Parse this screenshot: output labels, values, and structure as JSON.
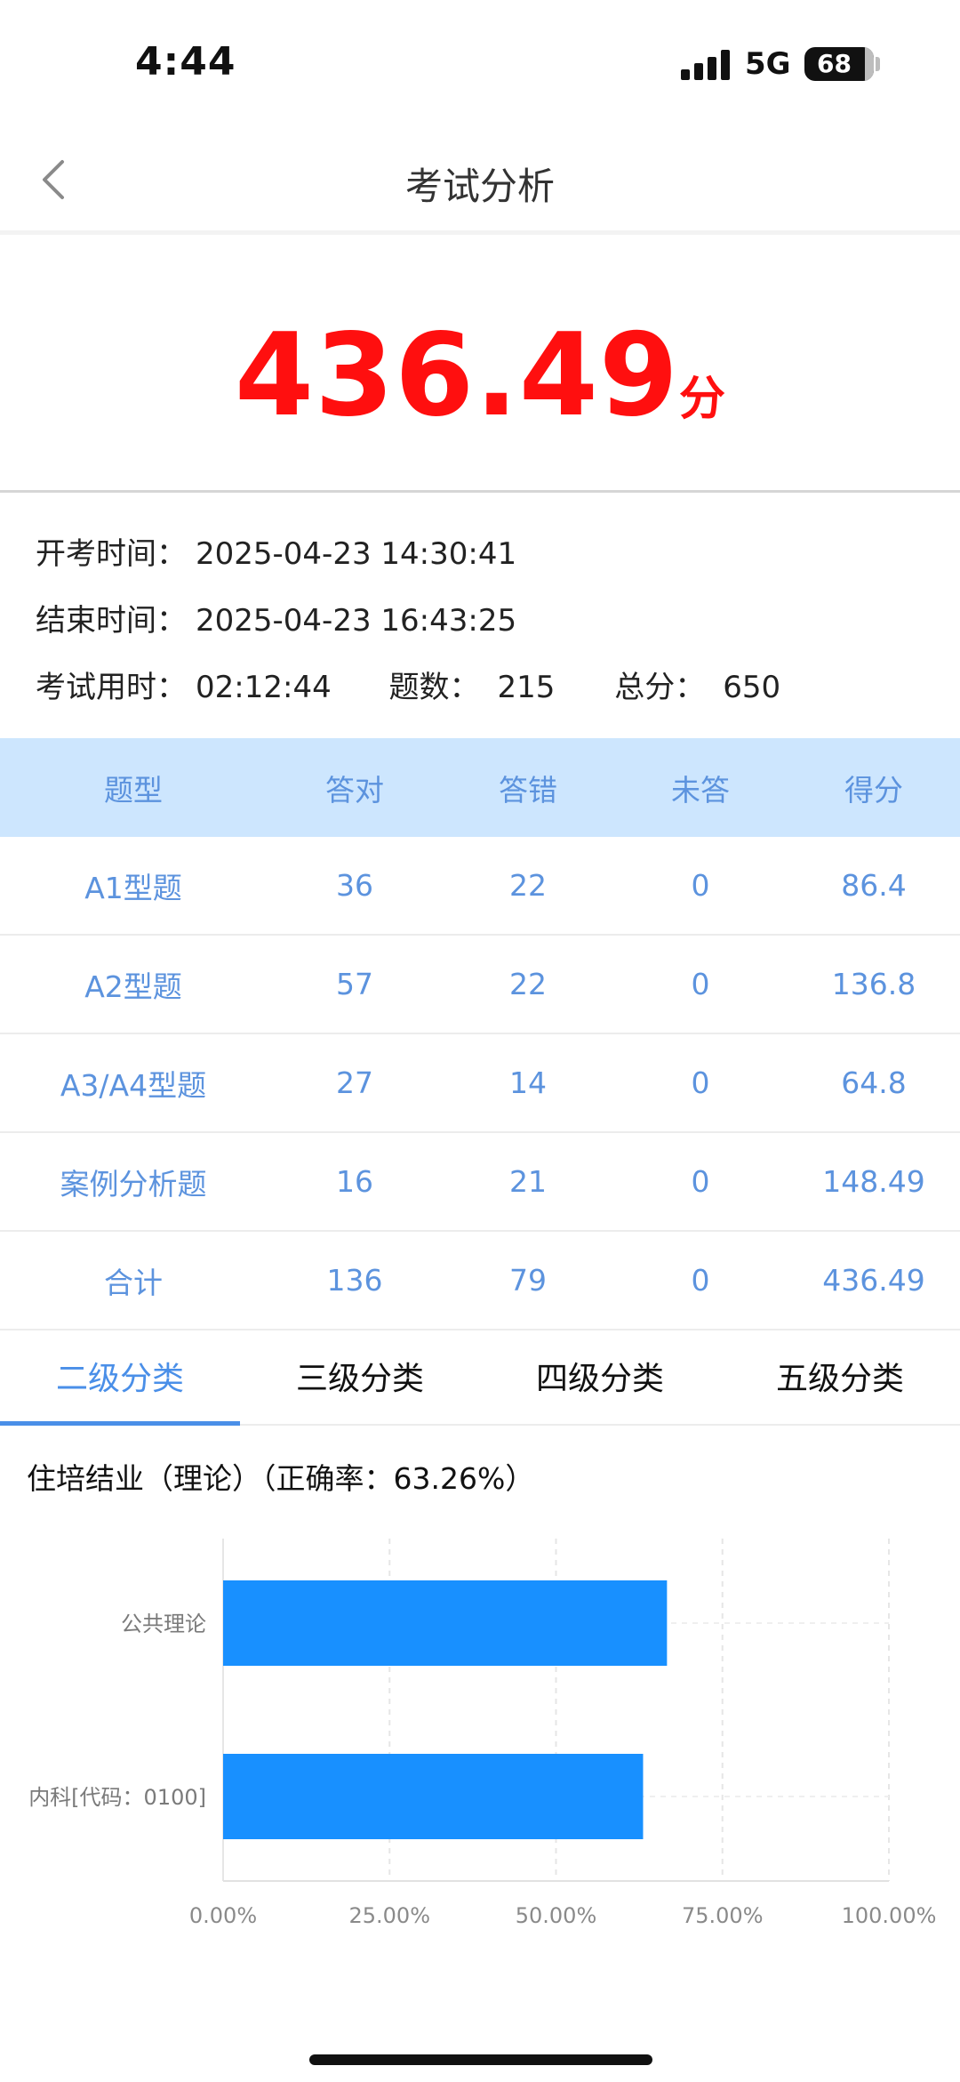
{
  "status_bar": {
    "time": "4:44",
    "network": "5G",
    "battery": "68"
  },
  "nav": {
    "title": "考试分析",
    "back_icon": "chevron-left-icon"
  },
  "score": {
    "value": "436.49",
    "unit": "分",
    "color": "#ff0f0f"
  },
  "exam_info": {
    "start_label": "开考时间：",
    "start_value": "2025-04-23 14:30:41",
    "end_label": "结束时间：",
    "end_value": "2025-04-23 16:43:25",
    "duration_label": "考试用时：",
    "duration_value": "02:12:44",
    "count_label": "题数：",
    "count_value": "215",
    "total_label": "总分：",
    "total_value": "650"
  },
  "table": {
    "headers": [
      "题型",
      "答对",
      "答错",
      "未答",
      "得分"
    ],
    "rows": [
      [
        "A1型题",
        "36",
        "22",
        "0",
        "86.4"
      ],
      [
        "A2型题",
        "57",
        "22",
        "0",
        "136.8"
      ],
      [
        "A3/A4型题",
        "27",
        "14",
        "0",
        "64.8"
      ],
      [
        "案例分析题",
        "16",
        "21",
        "0",
        "148.49"
      ],
      [
        "合计",
        "136",
        "79",
        "0",
        "436.49"
      ]
    ]
  },
  "tabs": [
    {
      "label": "二级分类",
      "active": true
    },
    {
      "label": "三级分类",
      "active": false
    },
    {
      "label": "四级分类",
      "active": false
    },
    {
      "label": "五级分类",
      "active": false
    }
  ],
  "section": {
    "title": "住培结业（理论）（正确率：63.26%）"
  },
  "chart_data": {
    "type": "bar",
    "orientation": "horizontal",
    "categories": [
      "公共理论",
      "内科[代码：0100]"
    ],
    "values": [
      0.6667,
      0.6308
    ],
    "xlim": [
      0,
      1
    ],
    "x_ticks": [
      "0.00%",
      "25.00%",
      "50.00%",
      "75.00%",
      "100.00%"
    ],
    "grid": true,
    "color": "#1890ff"
  }
}
